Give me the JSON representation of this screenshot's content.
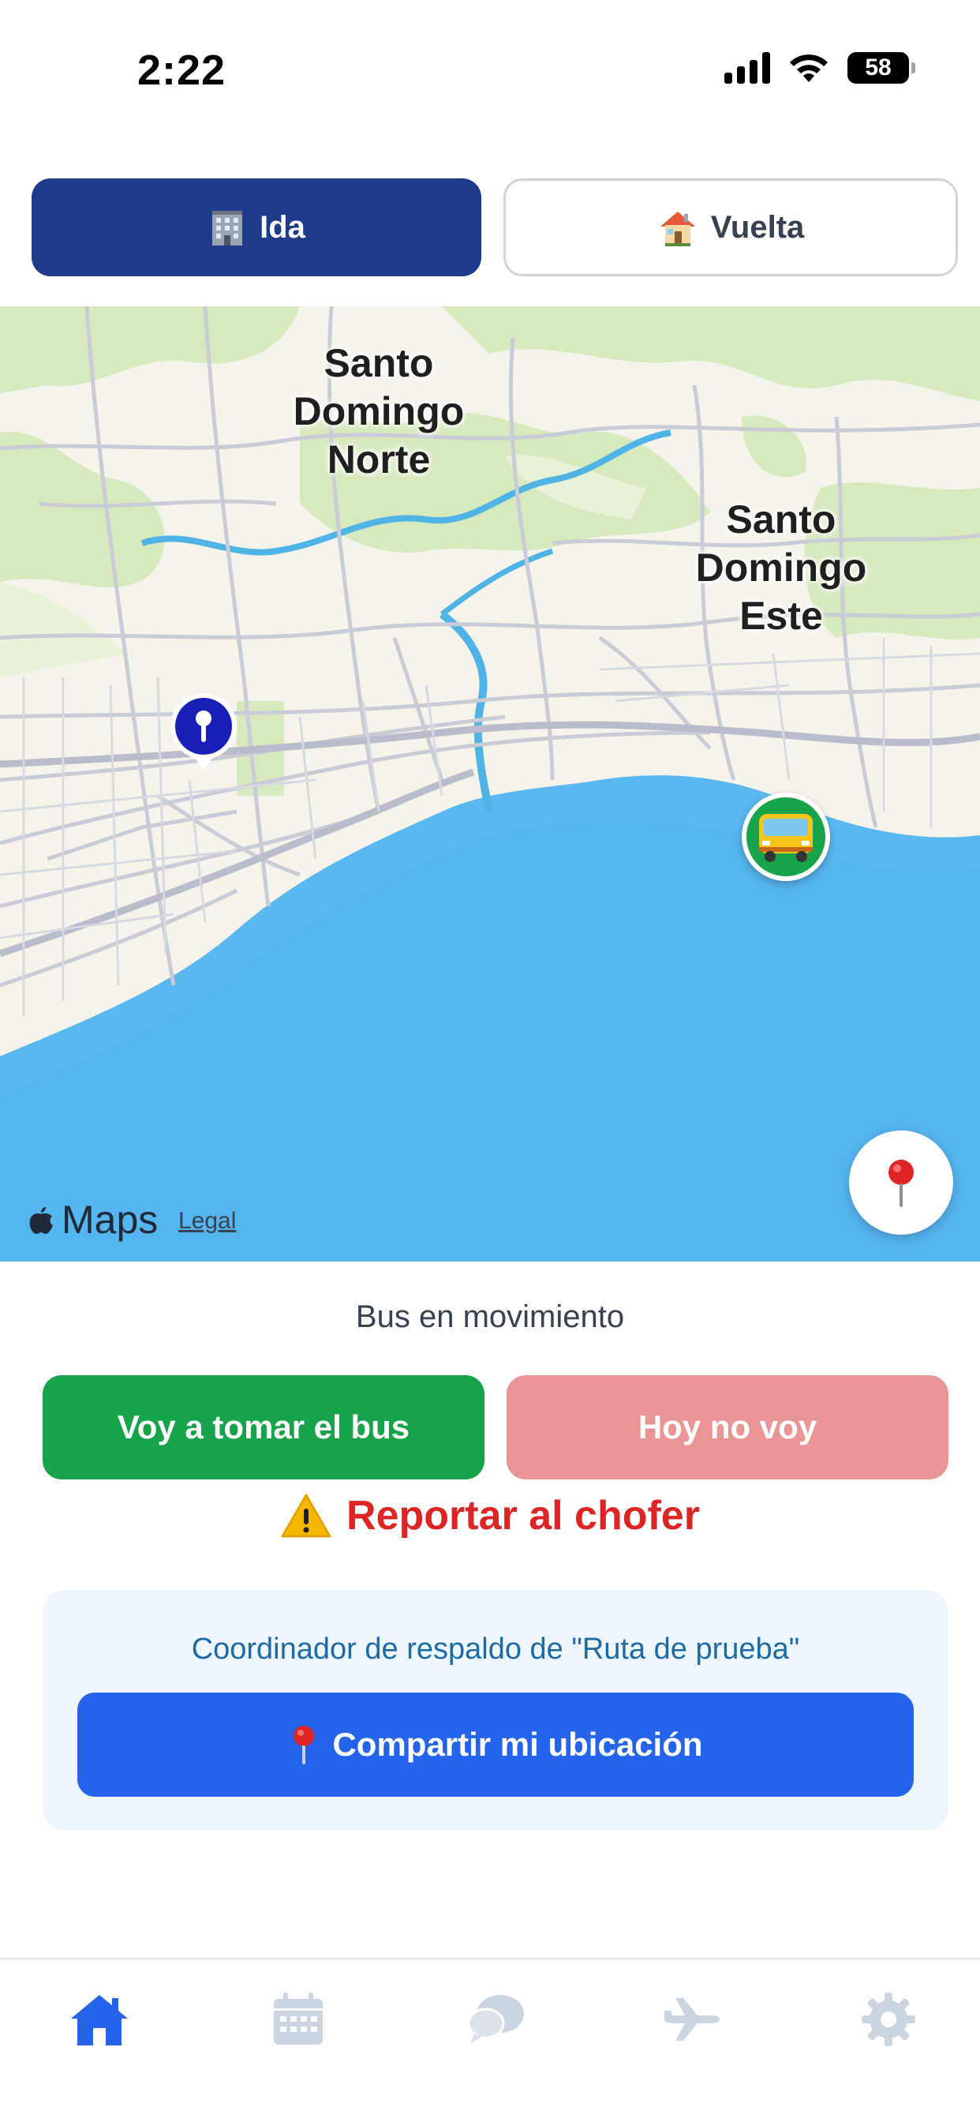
{
  "status_bar": {
    "time": "2:22",
    "battery": "58",
    "battery_level": 0.58
  },
  "toggle": {
    "ida": {
      "label": "Ida",
      "icon": "office-building-icon",
      "active": true
    },
    "vuelta": {
      "label": "Vuelta",
      "icon": "house-icon",
      "active": false
    }
  },
  "map": {
    "labels": {
      "norte": "Santo\nDomingo\nNorte",
      "este": "Santo\nDomingo\nEste"
    },
    "attribution": {
      "brand": "Maps",
      "legal": "Legal"
    },
    "colors": {
      "sea": "#5ab8f0",
      "land": "#f6f3ea",
      "park": "#d7ebc0",
      "road": "#c9cbd6",
      "river": "#4fb3e6"
    }
  },
  "bus_status": "Bus en movimiento",
  "actions": {
    "go_label": "Voy a tomar el bus",
    "skip_label": "Hoy no voy"
  },
  "report": {
    "label": "Reportar al chofer"
  },
  "coordinator": {
    "title": "Coordinador de respaldo de \"Ruta de prueba\"",
    "share_label": "Compartir mi ubicación"
  },
  "tab_bar": {
    "items": [
      "home-icon",
      "calendar-icon",
      "chat-icon",
      "airplane-icon",
      "settings-icon"
    ],
    "active": "home-icon",
    "active_color": "#2563eb",
    "inactive_color": "#cbd5e1"
  },
  "colors": {
    "primary": "#1e3a8a",
    "green": "#16a34a",
    "danger": "#dc2626",
    "share": "#2563eb"
  }
}
